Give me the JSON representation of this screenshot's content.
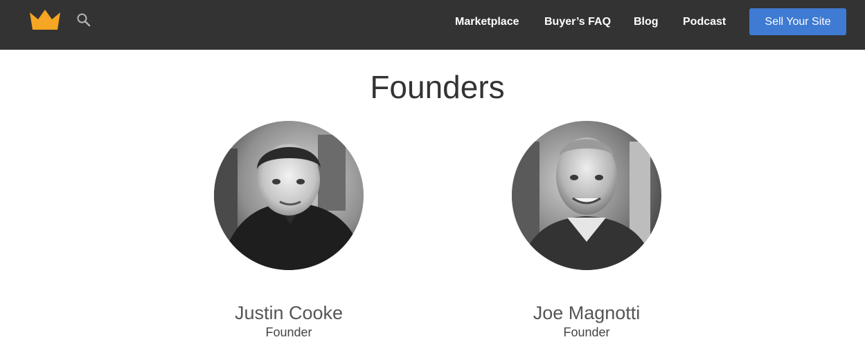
{
  "header": {
    "logo_icon": "crown-icon",
    "logo_color": "#f5a623",
    "search_icon": "search-icon",
    "background": "#333333",
    "nav": [
      {
        "label": "Marketplace"
      },
      {
        "label": "Buyer’s FAQ"
      },
      {
        "label": "Blog"
      },
      {
        "label": "Podcast"
      }
    ],
    "cta": {
      "label": "Sell Your Site",
      "color": "#3f7ad3"
    }
  },
  "main": {
    "title": "Founders",
    "founders": [
      {
        "name": "Justin Cooke",
        "role": "Founder",
        "photo_icon": "founder-photo-justin"
      },
      {
        "name": "Joe Magnotti",
        "role": "Founder",
        "photo_icon": "founder-photo-joe"
      }
    ]
  }
}
